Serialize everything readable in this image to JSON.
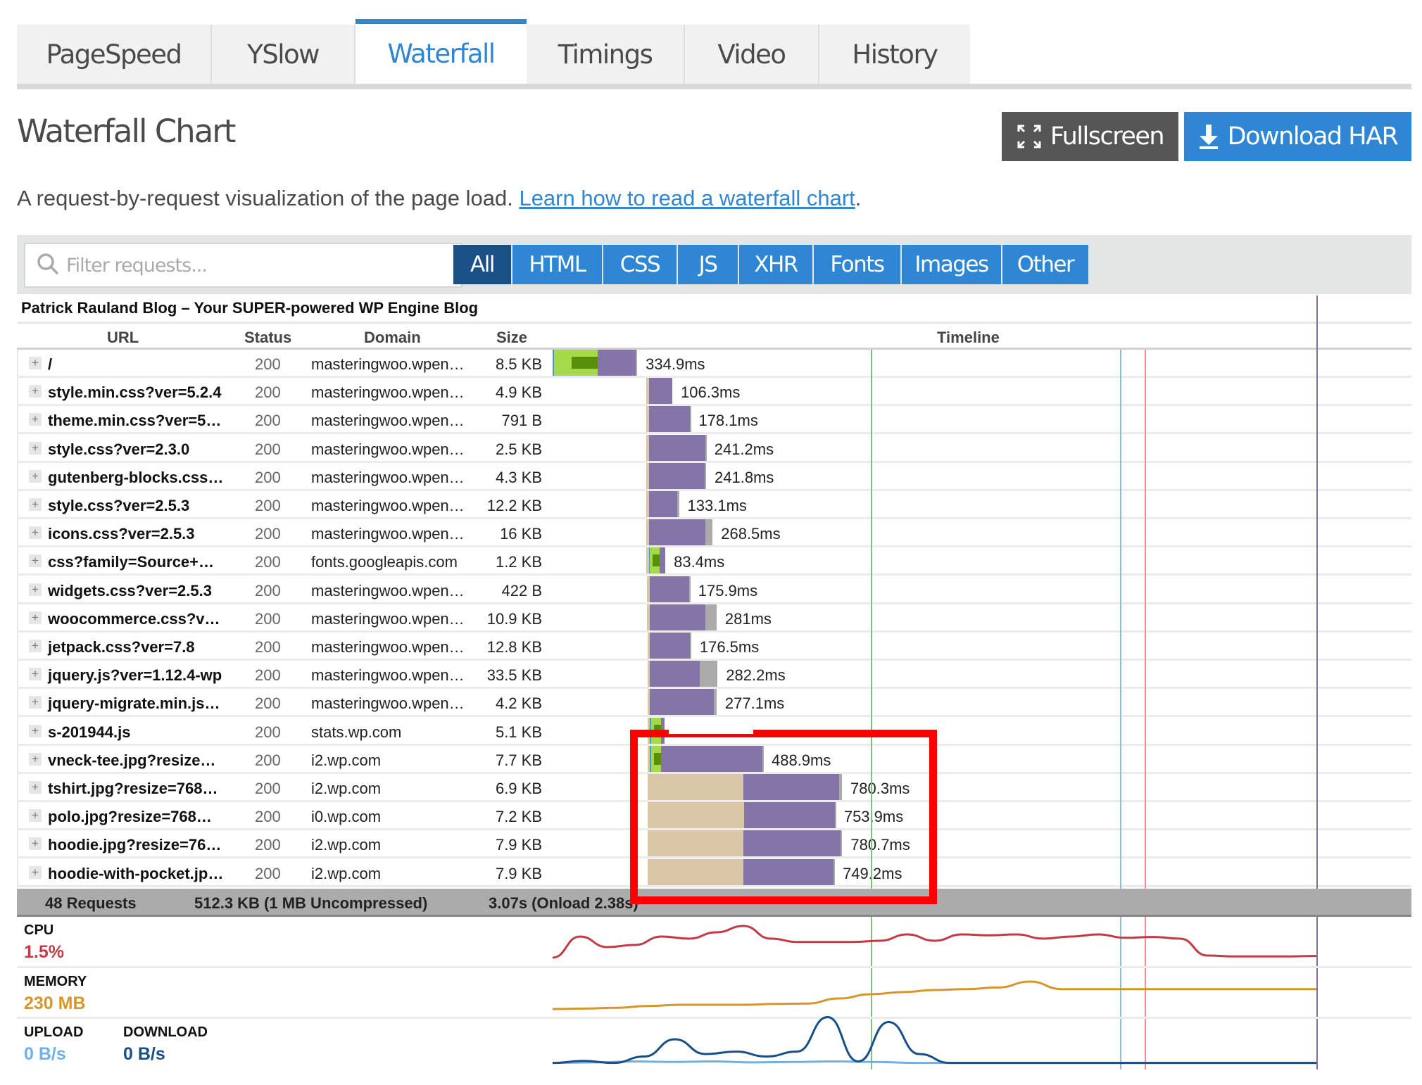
{
  "tabs": [
    {
      "label": "PageSpeed",
      "active": false
    },
    {
      "label": "YSlow",
      "active": false
    },
    {
      "label": "Waterfall",
      "active": true
    },
    {
      "label": "Timings",
      "active": false
    },
    {
      "label": "Video",
      "active": false
    },
    {
      "label": "History",
      "active": false
    }
  ],
  "page_title": "Waterfall Chart",
  "buttons": {
    "fullscreen": "Fullscreen",
    "download_har": "Download HAR"
  },
  "description": {
    "text": "A request-by-request visualization of the page load. ",
    "link": "Learn how to read a waterfall chart",
    "suffix": "."
  },
  "filter": {
    "placeholder": "Filter requests...",
    "value": "",
    "types": [
      "All",
      "HTML",
      "CSS",
      "JS",
      "XHR",
      "Fonts",
      "Images",
      "Other"
    ],
    "active_type": "All"
  },
  "site_title": "Patrick Rauland Blog – Your SUPER-powered WP Engine Blog",
  "columns": {
    "url": "URL",
    "status": "Status",
    "domain": "Domain",
    "size": "Size",
    "timeline": "Timeline"
  },
  "colors": {
    "accent": "#2f86d3",
    "active_filter": "#1b5086",
    "dns": "#3fa1bf",
    "connect": "#a5d94a",
    "ssl": "#5a8f0c",
    "blocked": "#dbc6a8",
    "wait": "#8574a8",
    "receive": "#aaaaaa",
    "first_paint": "#7fbf7f",
    "dom_loaded": "#88bde3",
    "onload": "#ee8e93",
    "fully_loaded": "#8a6a9a",
    "cpu": "#c23a45",
    "memory": "#d69629",
    "upload": "#6fb0e6",
    "download": "#174f86",
    "highlight": "#ff0000"
  },
  "timeline": {
    "total_ms": 3070,
    "markers_ms": {
      "first_paint": 1280,
      "dom_loaded": 2280,
      "onload": 2380,
      "fully_loaded": 3070
    }
  },
  "requests": [
    {
      "url": "/",
      "status": "200",
      "domain": "masteringwoo.wpen…",
      "size": "8.5 KB",
      "duration": "334.9ms",
      "start_ms": 0,
      "blocked_ms": 0,
      "dns_ms": 5,
      "connect_ms": 175,
      "ssl_ms": [
        70,
        175
      ],
      "wait_ms": 155,
      "receive_ms": 5
    },
    {
      "url": "style.min.css?ver=5.2.4",
      "status": "200",
      "domain": "masteringwoo.wpen…",
      "size": "4.9 KB",
      "duration": "106.3ms",
      "start_ms": 375,
      "blocked_ms": 12,
      "wait_ms": 94,
      "receive_ms": 0
    },
    {
      "url": "theme.min.css?ver=5…",
      "status": "200",
      "domain": "masteringwoo.wpen…",
      "size": "791 B",
      "duration": "178.1ms",
      "start_ms": 375,
      "blocked_ms": 12,
      "wait_ms": 164,
      "receive_ms": 2
    },
    {
      "url": "style.css?ver=2.3.0",
      "status": "200",
      "domain": "masteringwoo.wpen…",
      "size": "2.5 KB",
      "duration": "241.2ms",
      "start_ms": 375,
      "blocked_ms": 12,
      "wait_ms": 228,
      "receive_ms": 1
    },
    {
      "url": "gutenberg-blocks.css…",
      "status": "200",
      "domain": "masteringwoo.wpen…",
      "size": "4.3 KB",
      "duration": "241.8ms",
      "start_ms": 375,
      "blocked_ms": 12,
      "wait_ms": 225,
      "receive_ms": 5
    },
    {
      "url": "style.css?ver=2.5.3",
      "status": "200",
      "domain": "masteringwoo.wpen…",
      "size": "12.2 KB",
      "duration": "133.1ms",
      "start_ms": 375,
      "blocked_ms": 12,
      "wait_ms": 115,
      "receive_ms": 6
    },
    {
      "url": "icons.css?ver=2.5.3",
      "status": "200",
      "domain": "masteringwoo.wpen…",
      "size": "16 KB",
      "duration": "268.5ms",
      "start_ms": 375,
      "blocked_ms": 12,
      "wait_ms": 228,
      "receive_ms": 28
    },
    {
      "url": "css?family=Source+…",
      "status": "200",
      "domain": "fonts.googleapis.com",
      "size": "1.2 KB",
      "duration": "83.4ms",
      "start_ms": 375,
      "blocked_ms": 12,
      "dns_ms": 4,
      "connect_ms": 38,
      "ssl_ms": [
        10,
        38
      ],
      "wait_ms": 24,
      "receive_ms": 0
    },
    {
      "url": "widgets.css?ver=2.5.3",
      "status": "200",
      "domain": "masteringwoo.wpen…",
      "size": "422 B",
      "duration": "175.9ms",
      "start_ms": 378,
      "blocked_ms": 12,
      "wait_ms": 160,
      "receive_ms": 1
    },
    {
      "url": "woocommerce.css?v…",
      "status": "200",
      "domain": "masteringwoo.wpen…",
      "size": "10.9 KB",
      "duration": "281ms",
      "start_ms": 378,
      "blocked_ms": 12,
      "wait_ms": 225,
      "receive_ms": 44
    },
    {
      "url": "jetpack.css?ver=7.8",
      "status": "200",
      "domain": "masteringwoo.wpen…",
      "size": "12.8 KB",
      "duration": "176.5ms",
      "start_ms": 383,
      "blocked_ms": 8,
      "wait_ms": 160,
      "receive_ms": 6
    },
    {
      "url": "jquery.js?ver=1.12.4-wp",
      "status": "200",
      "domain": "masteringwoo.wpen…",
      "size": "33.5 KB",
      "duration": "282.2ms",
      "start_ms": 383,
      "blocked_ms": 8,
      "wait_ms": 200,
      "receive_ms": 72
    },
    {
      "url": "jquery-migrate.min.js…",
      "status": "200",
      "domain": "masteringwoo.wpen…",
      "size": "4.2 KB",
      "duration": "277.1ms",
      "start_ms": 383,
      "blocked_ms": 8,
      "wait_ms": 258,
      "receive_ms": 10
    },
    {
      "url": "s-201944.js",
      "status": "200",
      "domain": "stats.wp.com",
      "size": "5.1 KB",
      "duration": "",
      "start_ms": 383,
      "blocked_ms": 8,
      "dns_ms": 6,
      "connect_ms": 40,
      "ssl_ms": [
        10,
        40
      ],
      "wait_ms": 12,
      "receive_ms": 0
    },
    {
      "url": "vneck-tee.jpg?resize…",
      "status": "200",
      "domain": "i2.wp.com",
      "size": "7.7 KB",
      "duration": "488.9ms",
      "start_ms": 383,
      "blocked_ms": 8,
      "dns_ms": 6,
      "connect_ms": 40,
      "ssl_ms": [
        10,
        40
      ],
      "wait_ms": 405,
      "receive_ms": 4
    },
    {
      "url": "tshirt.jpg?resize=768…",
      "status": "200",
      "domain": "i2.wp.com",
      "size": "6.9 KB",
      "duration": "780.3ms",
      "start_ms": 383,
      "blocked_ms": 383,
      "wait_ms": 385,
      "receive_ms": 12
    },
    {
      "url": "polo.jpg?resize=768…",
      "status": "200",
      "domain": "i0.wp.com",
      "size": "7.2 KB",
      "duration": "753.9ms",
      "start_ms": 383,
      "blocked_ms": 386,
      "wait_ms": 365,
      "receive_ms": 3
    },
    {
      "url": "hoodie.jpg?resize=76…",
      "status": "200",
      "domain": "i2.wp.com",
      "size": "7.9 KB",
      "duration": "780.7ms",
      "start_ms": 383,
      "blocked_ms": 383,
      "wait_ms": 392,
      "receive_ms": 6
    },
    {
      "url": "hoodie-with-pocket.jp…",
      "status": "200",
      "domain": "i2.wp.com",
      "size": "7.9 KB",
      "duration": "749.2ms",
      "start_ms": 383,
      "blocked_ms": 383,
      "wait_ms": 364,
      "receive_ms": 2
    }
  ],
  "summary": {
    "requests": "48 Requests",
    "size": "512.3 KB  (1 MB Uncompressed)",
    "time": "3.07s  (Onload 2.38s)"
  },
  "metrics": {
    "cpu": {
      "label": "CPU",
      "value": "1.5%",
      "series": [
        0.05,
        0.55,
        0.3,
        0.35,
        0.55,
        0.5,
        0.65,
        0.8,
        0.5,
        0.42,
        0.42,
        0.42,
        0.45,
        0.6,
        0.45,
        0.6,
        0.58,
        0.6,
        0.5,
        0.55,
        0.6,
        0.52,
        0.54,
        0.5,
        0.1,
        0.08,
        0.08,
        0.08,
        0.09
      ]
    },
    "memory": {
      "label": "MEMORY",
      "value": "230 MB",
      "series": [
        0.05,
        0.06,
        0.08,
        0.12,
        0.15,
        0.15,
        0.15,
        0.17,
        0.18,
        0.3,
        0.4,
        0.45,
        0.5,
        0.52,
        0.56,
        0.7,
        0.52,
        0.52,
        0.52,
        0.52,
        0.52,
        0.52,
        0.52,
        0.52,
        0.52
      ]
    },
    "upload": {
      "label": "UPLOAD",
      "value": "0 B/s",
      "series": [
        0.02,
        0.03,
        0.05,
        0.04,
        0.05,
        0.03,
        0.04,
        0.05,
        0.04,
        0.02,
        0.02,
        0.02,
        0.02,
        0.02,
        0.02,
        0.02,
        0.02,
        0.02,
        0.02,
        0.02
      ]
    },
    "download": {
      "label": "DOWNLOAD",
      "value": "0 B/s",
      "series": [
        0.02,
        0.06,
        0.02,
        0.15,
        0.5,
        0.2,
        0.25,
        0.15,
        0.25,
        0.95,
        0.05,
        0.85,
        0.2,
        0.02,
        0.02,
        0.02,
        0.02,
        0.02,
        0.02,
        0.02,
        0.02,
        0.02,
        0.02,
        0.02,
        0.02,
        0.02
      ]
    }
  }
}
